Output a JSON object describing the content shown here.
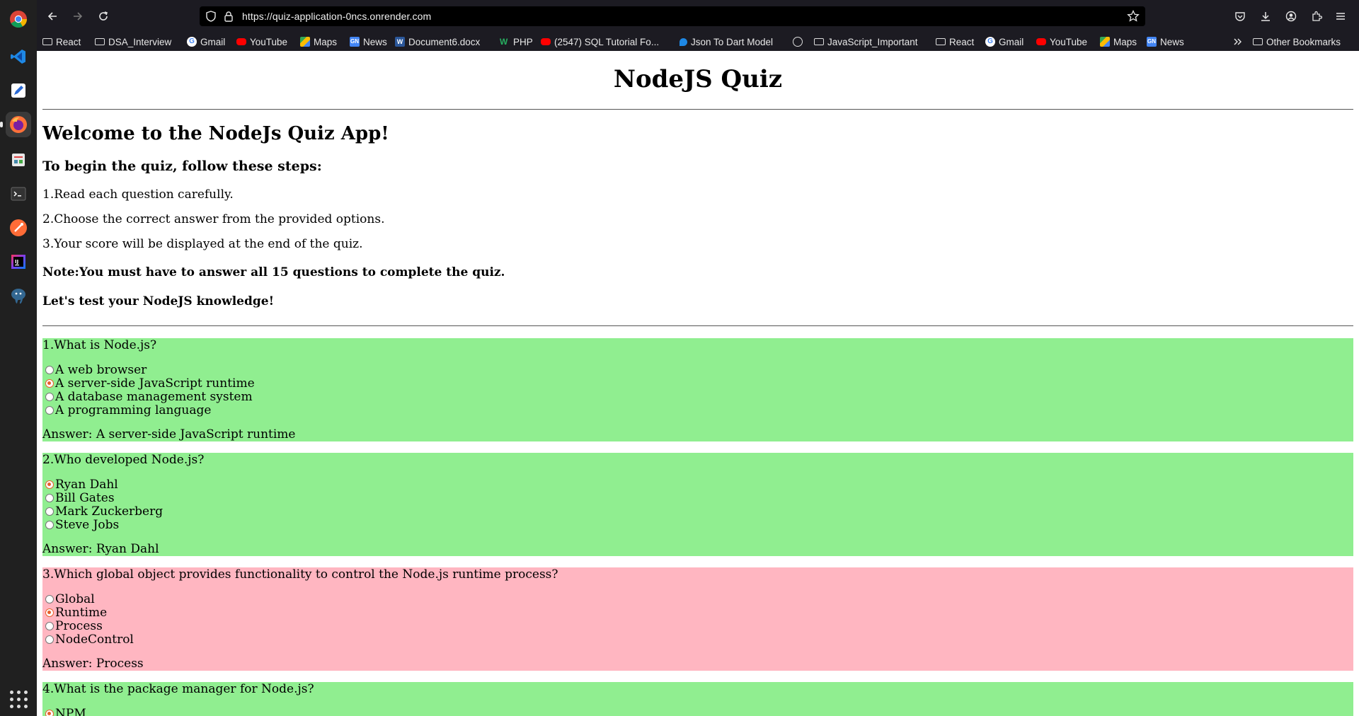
{
  "browser": {
    "url": "https://quiz-application-0ncs.onrender.com",
    "bookmarks": [
      {
        "label": "React",
        "icon": "folder"
      },
      {
        "label": "DSA_Interview",
        "icon": "folder"
      },
      {
        "label": "Gmail",
        "icon": "google"
      },
      {
        "label": "YouTube",
        "icon": "youtube"
      },
      {
        "label": "Maps",
        "icon": "maps"
      },
      {
        "label": "News",
        "icon": "news"
      },
      {
        "label": "Document6.docx",
        "icon": "word"
      },
      {
        "label": "PHP",
        "icon": "php"
      },
      {
        "label": "(2547) SQL Tutorial Fo...",
        "icon": "youtube"
      },
      {
        "label": "Json To Dart Model",
        "icon": "json"
      },
      {
        "label": "",
        "icon": "globe"
      },
      {
        "label": "JavaScript_Important",
        "icon": "folder"
      },
      {
        "label": "React",
        "icon": "folder"
      },
      {
        "label": "Gmail",
        "icon": "google"
      },
      {
        "label": "YouTube",
        "icon": "youtube"
      },
      {
        "label": "Maps",
        "icon": "maps"
      },
      {
        "label": "News",
        "icon": "news"
      }
    ],
    "other_bookmarks": "Other Bookmarks"
  },
  "page": {
    "title": "NodeJS Quiz",
    "welcome": "Welcome to the NodeJs Quiz App!",
    "steps_title": "To begin the quiz, follow these steps:",
    "steps": [
      "1.Read each question carefully.",
      "2.Choose the correct answer from the provided options.",
      "3.Your score will be displayed at the end of the quiz."
    ],
    "note": "Note:You must have to answer all 15 questions to complete the quiz.",
    "cta": "Let's test your NodeJS knowledge!"
  },
  "questions": [
    {
      "text": "1.What is Node.js?",
      "status": "correct",
      "options": [
        "A web browser",
        "A server-side JavaScript runtime",
        "A database management system",
        "A programming language"
      ],
      "selected": 1,
      "answer": "Answer: A server-side JavaScript runtime"
    },
    {
      "text": "2.Who developed Node.js?",
      "status": "correct",
      "options": [
        "Ryan Dahl",
        "Bill Gates",
        "Mark Zuckerberg",
        "Steve Jobs"
      ],
      "selected": 0,
      "answer": "Answer: Ryan Dahl"
    },
    {
      "text": "3.Which global object provides functionality to control the Node.js runtime process?",
      "status": "wrong",
      "options": [
        "Global",
        "Runtime",
        "Process",
        "NodeControl"
      ],
      "selected": 1,
      "answer": "Answer: Process"
    },
    {
      "text": "4.What is the package manager for Node.js?",
      "status": "correct",
      "options": [
        "NPM"
      ],
      "selected": 0,
      "answer": ""
    }
  ],
  "colors": {
    "correct": "#90ee90",
    "wrong": "#ffb6c1",
    "radio_selected": "#e8602c"
  }
}
